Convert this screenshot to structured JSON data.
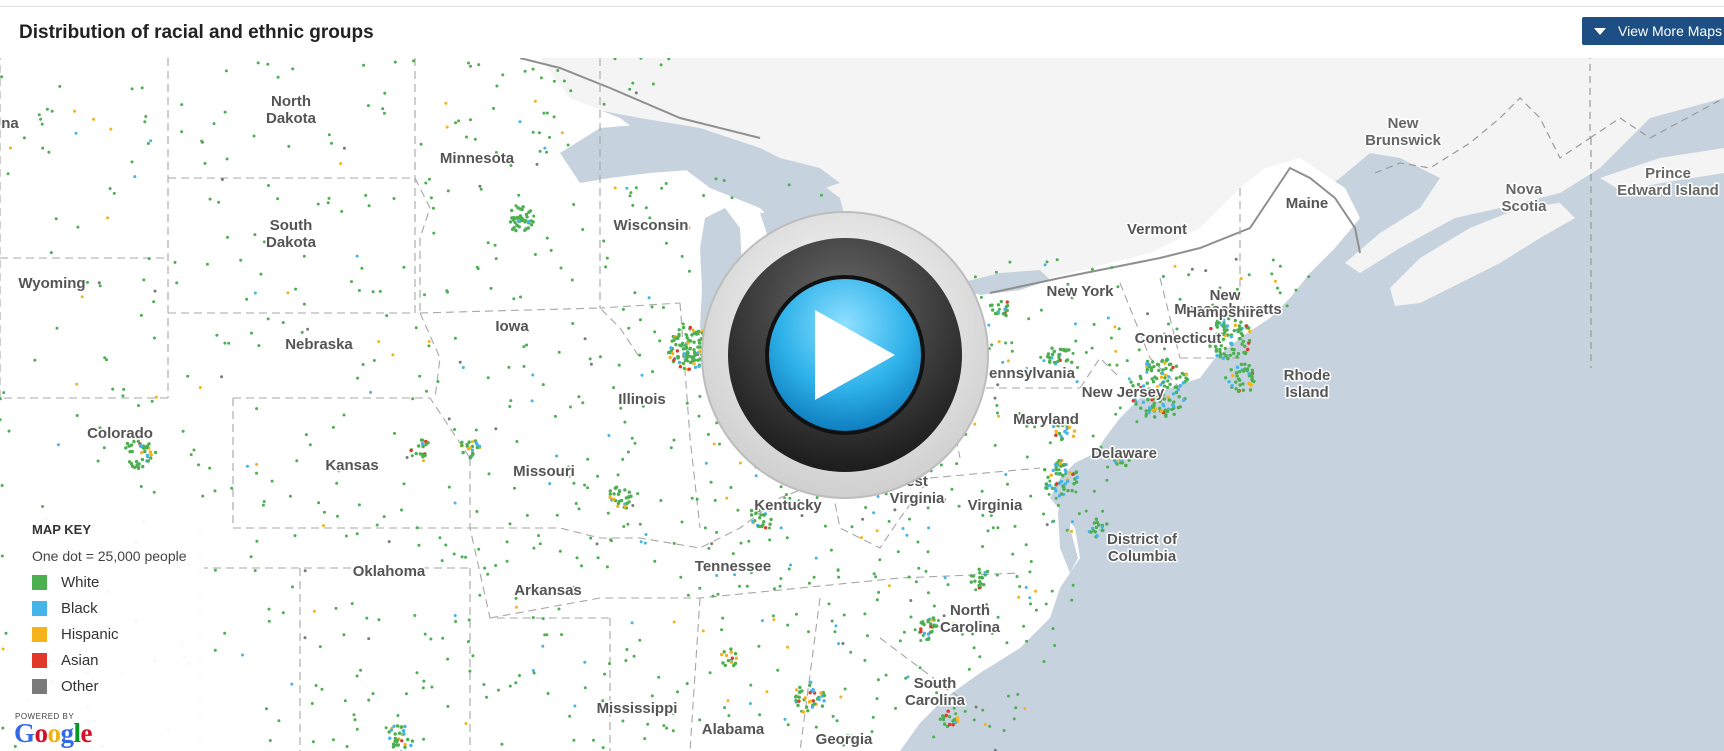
{
  "header": {
    "title": "Distribution of racial and ethnic groups",
    "view_more_label": "View More Maps"
  },
  "map": {
    "labels": [
      {
        "id": "label-north-dakota",
        "lines": [
          "North",
          "Dakota"
        ]
      },
      {
        "id": "label-south-dakota",
        "lines": [
          "South",
          "Dakota"
        ]
      },
      {
        "id": "label-montana-partial",
        "lines": [
          "na"
        ]
      },
      {
        "id": "label-wyoming",
        "lines": [
          "Wyoming"
        ]
      },
      {
        "id": "label-minnesota",
        "lines": [
          "Minnesota"
        ]
      },
      {
        "id": "label-wisconsin",
        "lines": [
          "Wisconsin"
        ]
      },
      {
        "id": "label-iowa",
        "lines": [
          "Iowa"
        ]
      },
      {
        "id": "label-nebraska",
        "lines": [
          "Nebraska"
        ]
      },
      {
        "id": "label-colorado",
        "lines": [
          "Colorado"
        ]
      },
      {
        "id": "label-kansas",
        "lines": [
          "Kansas"
        ]
      },
      {
        "id": "label-missouri",
        "lines": [
          "Missouri"
        ]
      },
      {
        "id": "label-illinois",
        "lines": [
          "Illinois"
        ]
      },
      {
        "id": "label-oklahoma",
        "lines": [
          "Oklahoma"
        ]
      },
      {
        "id": "label-arkansas",
        "lines": [
          "Arkansas"
        ]
      },
      {
        "id": "label-tennessee",
        "lines": [
          "Tennessee"
        ]
      },
      {
        "id": "label-kentucky",
        "lines": [
          "Kentucky"
        ]
      },
      {
        "id": "label-mississippi",
        "lines": [
          "Mississippi"
        ]
      },
      {
        "id": "label-alabama",
        "lines": [
          "Alabama"
        ]
      },
      {
        "id": "label-georgia",
        "lines": [
          "Georgia"
        ]
      },
      {
        "id": "label-south-carolina",
        "lines": [
          "South",
          "Carolina"
        ]
      },
      {
        "id": "label-north-carolina",
        "lines": [
          "North",
          "Carolina"
        ]
      },
      {
        "id": "label-virginia",
        "lines": [
          "Virginia"
        ]
      },
      {
        "id": "label-west-virginia",
        "lines": [
          "est",
          "Virginia"
        ]
      },
      {
        "id": "label-maryland",
        "lines": [
          "Maryland"
        ]
      },
      {
        "id": "label-delaware",
        "lines": [
          "Delaware"
        ]
      },
      {
        "id": "label-district-of-columbia",
        "lines": [
          "District of",
          "Columbia"
        ]
      },
      {
        "id": "label-pennsylvania",
        "lines": [
          "ennsylvania"
        ]
      },
      {
        "id": "label-new-jersey",
        "lines": [
          "New Jersey"
        ]
      },
      {
        "id": "label-new-york",
        "lines": [
          "New York"
        ]
      },
      {
        "id": "label-connecticut",
        "lines": [
          "Connecticut"
        ]
      },
      {
        "id": "label-rhode-island",
        "lines": [
          "Rhode",
          "Island"
        ]
      },
      {
        "id": "label-massachusetts",
        "lines": [
          "Massachusetts"
        ]
      },
      {
        "id": "label-new-hampshire",
        "lines": [
          "New",
          "Hampshire"
        ]
      },
      {
        "id": "label-vermont",
        "lines": [
          "Vermont"
        ]
      },
      {
        "id": "label-maine",
        "lines": [
          "Maine"
        ]
      },
      {
        "id": "label-new-brunswick",
        "lines": [
          "New",
          "Brunswick"
        ]
      },
      {
        "id": "label-nova-scotia",
        "lines": [
          "Nova",
          "Scotia"
        ]
      },
      {
        "id": "label-prince-edward-island",
        "lines": [
          "Prince",
          "Edward Island"
        ]
      }
    ]
  },
  "legend": {
    "title": "MAP KEY",
    "scale": "One dot = 25,000 people",
    "items": [
      {
        "label": "White",
        "color": "#4caf50"
      },
      {
        "label": "Black",
        "color": "#45b4e8"
      },
      {
        "label": "Hispanic",
        "color": "#f5b21b"
      },
      {
        "label": "Asian",
        "color": "#e2382b"
      },
      {
        "label": "Other",
        "color": "#7a7a7a"
      }
    ]
  },
  "attribution": {
    "powered_by": "POWERED BY",
    "logo": "Google",
    "logo_colors": [
      "#3369e8",
      "#d50f25",
      "#eeb211",
      "#3369e8",
      "#009925",
      "#d50f25"
    ]
  },
  "play_button": {
    "icon": "play-icon",
    "colors": {
      "outer": "#e2e2e2",
      "ring": "#3a3a3a",
      "button": "#31b4ec"
    }
  },
  "colors": {
    "water": "#c6d3de",
    "land": "#ffffff",
    "canada": "#f4f4f4",
    "border": "#9a9a9a"
  }
}
